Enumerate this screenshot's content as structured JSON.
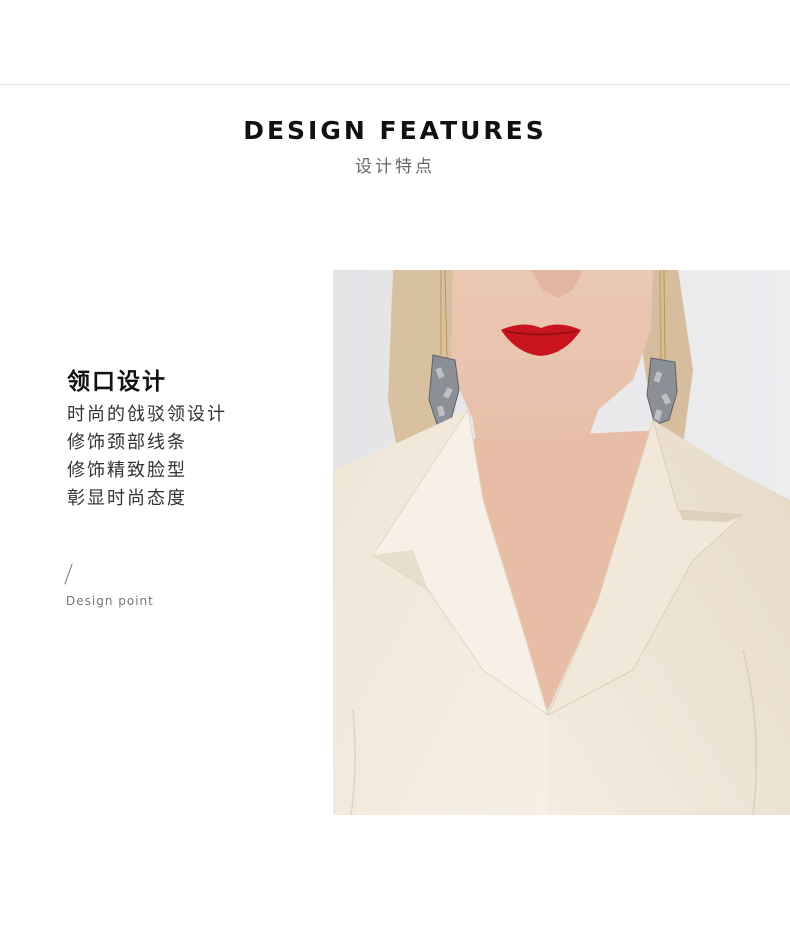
{
  "header": {
    "title": "DESIGN FEATURES",
    "subtitle": "设计特点"
  },
  "feature": {
    "heading": "领口设计",
    "lines": [
      "时尚的戗驳领设计",
      "修饰颈部线条",
      "修饰精致脸型",
      "彰显时尚态度"
    ],
    "design_point_label": "Design point"
  },
  "photo": {
    "subject": "model wearing cream blazer with long crystal drop earrings",
    "colors": {
      "background": "#e6e6e9",
      "skin": "#e8c2ad",
      "blazer": "#f3eadc",
      "lips": "#c8141c",
      "hair": "#d9c2a0",
      "crystal": "#8d8f96"
    }
  }
}
